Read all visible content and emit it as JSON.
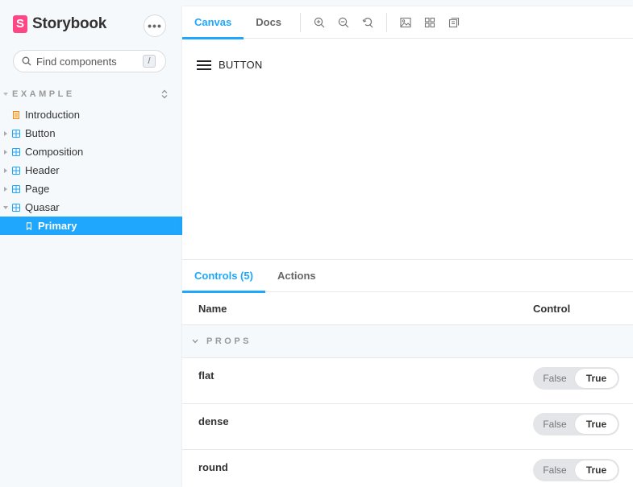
{
  "brand": {
    "logo_letter": "S",
    "name": "Storybook",
    "accent": "#ff4785"
  },
  "menu": {
    "icon": "ellipsis-icon",
    "label": "•••"
  },
  "search": {
    "placeholder": "Find components",
    "shortcut": "/"
  },
  "sidebar": {
    "group_label": "EXAMPLE",
    "items": [
      {
        "label": "Introduction",
        "icon": "document-icon",
        "caret": false
      },
      {
        "label": "Button",
        "icon": "component-icon",
        "caret": "closed"
      },
      {
        "label": "Composition",
        "icon": "component-icon",
        "caret": "closed"
      },
      {
        "label": "Header",
        "icon": "component-icon",
        "caret": "closed"
      },
      {
        "label": "Page",
        "icon": "component-icon",
        "caret": "closed"
      },
      {
        "label": "Quasar",
        "icon": "component-icon",
        "caret": "open"
      },
      {
        "label": "Primary",
        "icon": "bookmark-icon",
        "caret": false,
        "selected": true
      }
    ]
  },
  "toolbar": {
    "tabs": [
      {
        "label": "Canvas",
        "active": true
      },
      {
        "label": "Docs",
        "active": false
      }
    ],
    "tools": [
      "zoom-in-icon",
      "zoom-out-icon",
      "zoom-reset-icon",
      "background-icon",
      "grid-icon",
      "outline-icon"
    ]
  },
  "canvas": {
    "button_label": "BUTTON"
  },
  "addons": {
    "tabs": [
      {
        "label": "Controls (5)",
        "active": true
      },
      {
        "label": "Actions",
        "active": false
      }
    ],
    "table": {
      "col_name": "Name",
      "col_control": "Control",
      "section": "PROPS",
      "rows": [
        {
          "name": "flat",
          "false_label": "False",
          "true_label": "True",
          "value": true
        },
        {
          "name": "dense",
          "false_label": "False",
          "true_label": "True",
          "value": true
        },
        {
          "name": "round",
          "false_label": "False",
          "true_label": "True",
          "value": true
        }
      ]
    }
  },
  "colors": {
    "primary": "#1ea7fd",
    "component_icon": "#1ea7fd",
    "document_icon": "#ff8700"
  }
}
